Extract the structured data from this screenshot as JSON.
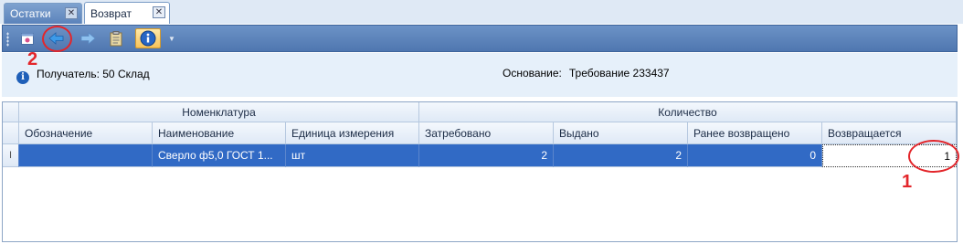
{
  "tabs": [
    {
      "label": "Остатки"
    },
    {
      "label": "Возврат"
    }
  ],
  "tab_close_glyph": "✕",
  "toolbar": {
    "buttons": [
      "calendar-icon",
      "back-arrow-icon",
      "forward-arrow-icon",
      "clipboard-icon",
      "info-icon"
    ]
  },
  "header": {
    "recipient": "Получатель: 50 Склад",
    "reason_label": "Основание:",
    "reason_value": "Требование 233437"
  },
  "grid": {
    "bands": [
      "Номенклатура",
      "Количество"
    ],
    "columns": [
      "Обозначение",
      "Наименование",
      "Единица измерения",
      "Затребовано",
      "Выдано",
      "Ранее возвращено",
      "Возвращается"
    ],
    "rows": [
      {
        "indicator": "I",
        "designation": "",
        "name": "Сверло ф5,0 ГОСТ 1...",
        "unit": "шт",
        "requested": "2",
        "issued": "2",
        "returned_before": "0",
        "returning": "1"
      }
    ]
  },
  "annotations": [
    "1",
    "2"
  ],
  "colors": {
    "toolbar": "#5a80b8",
    "selection": "#316ac5",
    "annotation": "#e3262b"
  }
}
